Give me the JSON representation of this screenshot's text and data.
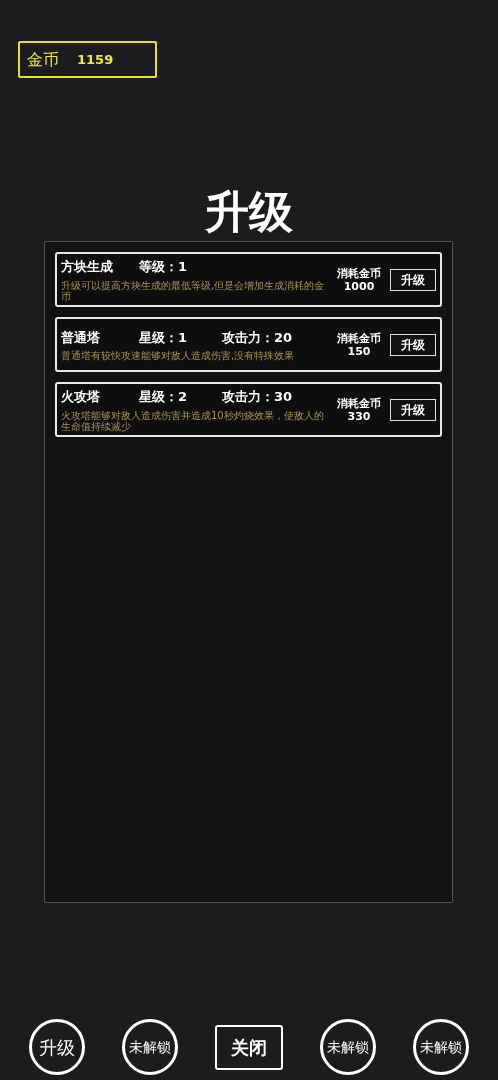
{
  "coins": {
    "label": "金币",
    "value": "1159"
  },
  "title": "升级",
  "cards": [
    {
      "name": "方块生成",
      "stats": [
        "等级：1"
      ],
      "description": "升级可以提高方块生成的最低等级,但是会增加生成消耗的金币",
      "cost_label": "消耗金币",
      "cost": "1000",
      "button": "升级"
    },
    {
      "name": "普通塔",
      "stats": [
        "星级：1",
        "攻击力：20"
      ],
      "description": "普通塔有较快攻速能够对敌人造成伤害,没有特殊效果",
      "cost_label": "消耗金币",
      "cost": "150",
      "button": "升级"
    },
    {
      "name": "火攻塔",
      "stats": [
        "星级：2",
        "攻击力：30"
      ],
      "description": "火攻塔能够对敌人造成伤害并造成10秒灼烧效果，使敌人的生命值持续减少",
      "cost_label": "消耗金币",
      "cost": "330",
      "button": "升级"
    }
  ],
  "bottom_buttons": [
    {
      "label": "升级",
      "kind": "circle"
    },
    {
      "label": "未解锁",
      "kind": "circle"
    },
    {
      "label": "关闭",
      "kind": "rect"
    },
    {
      "label": "未解锁",
      "kind": "circle"
    },
    {
      "label": "未解锁",
      "kind": "circle"
    }
  ]
}
